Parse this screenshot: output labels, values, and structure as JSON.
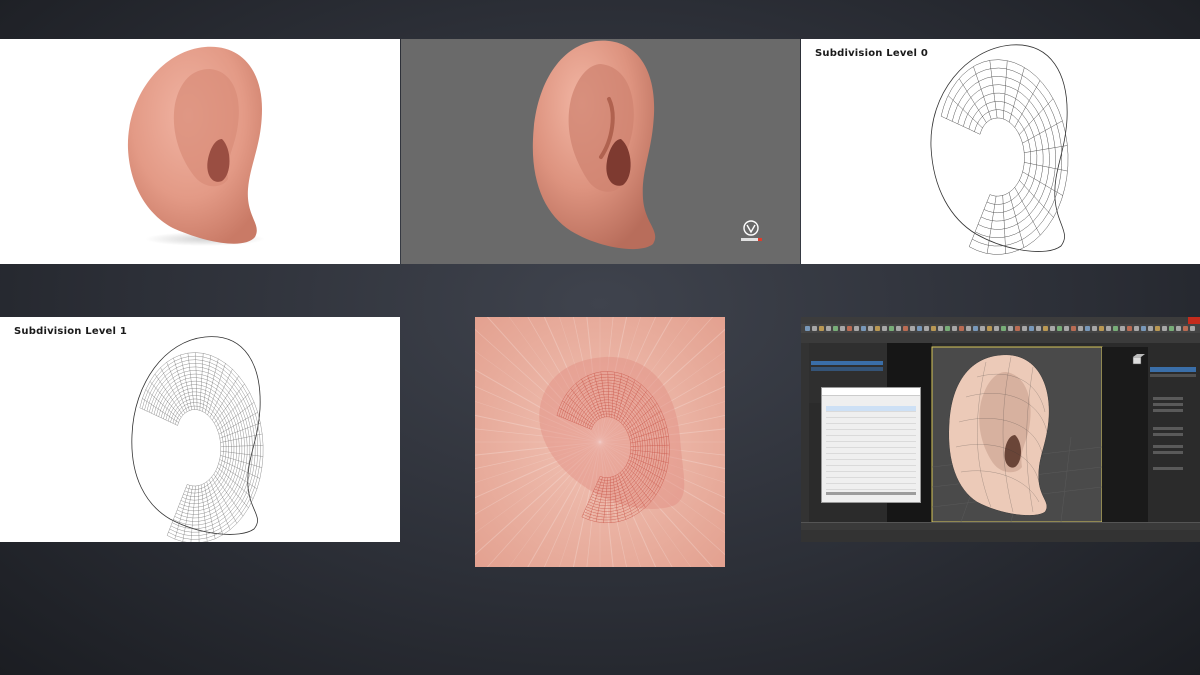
{
  "panels": {
    "render_white": {},
    "render_grey": {},
    "wireframe_level0": {
      "label": "Subdivision Level 0"
    },
    "wireframe_level1": {
      "label": "Subdivision Level 1"
    },
    "uv_texture": {},
    "app_screenshot": {}
  },
  "colors": {
    "skin_light": "#e8a18f",
    "skin_dark": "#b85f50",
    "wire": "#555555",
    "uv_wire": "#c9574a",
    "accent_blue": "#2f6fb3"
  },
  "icons": {
    "watermark": "shield-logo-icon",
    "close": "close-icon",
    "gizmo": "viewcube-icon"
  }
}
